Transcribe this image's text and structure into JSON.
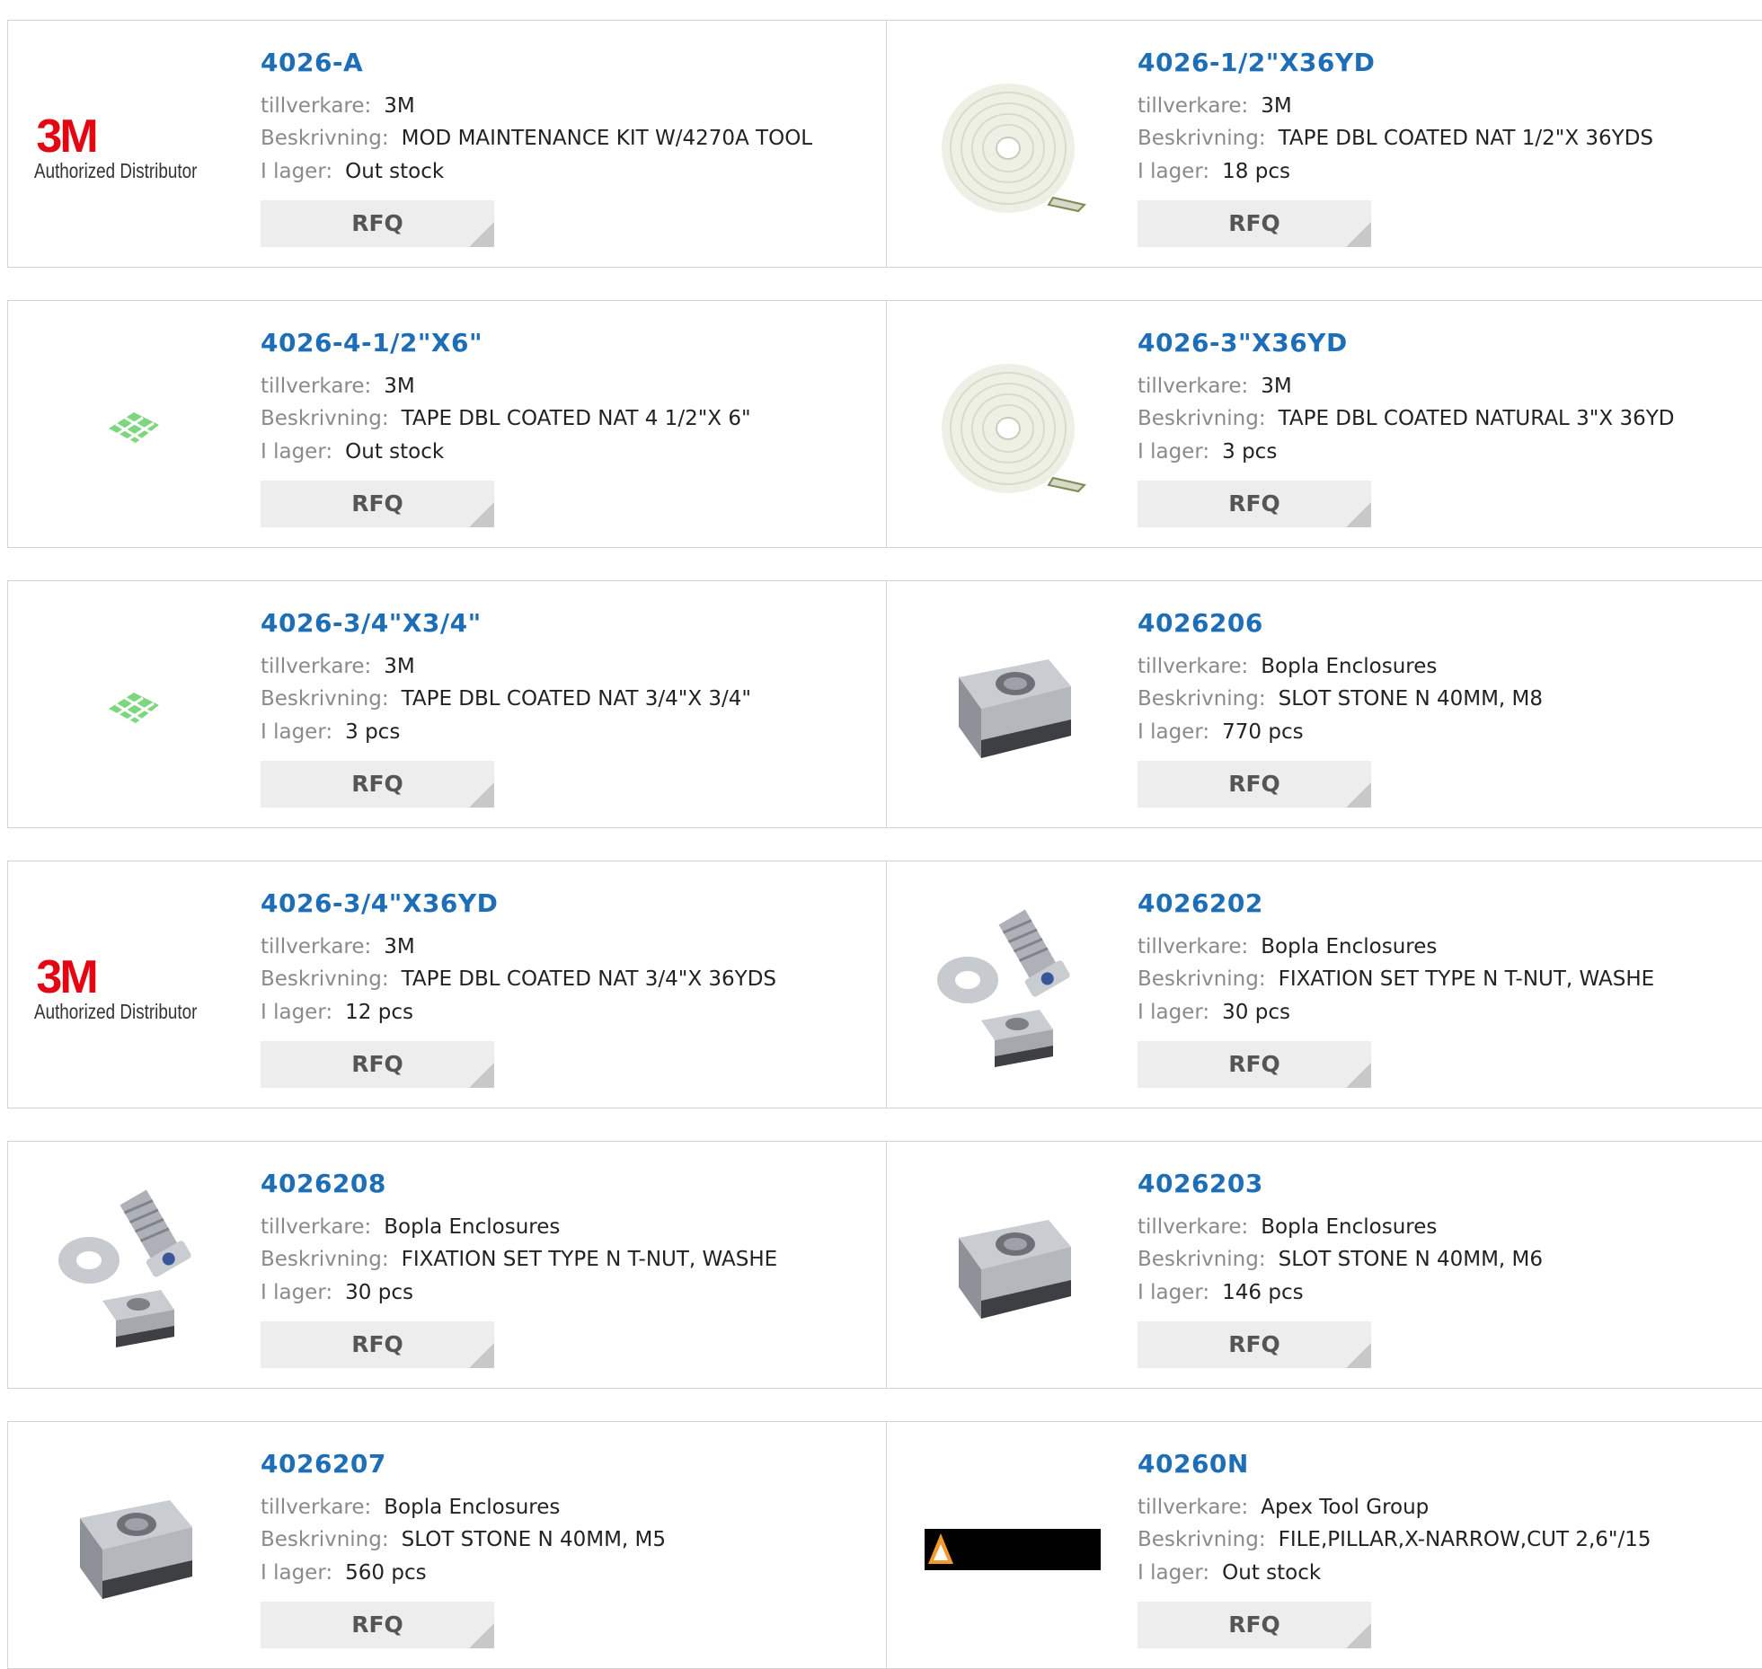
{
  "labels": {
    "manufacturer": "tillverkare:",
    "description": "Beskrivning:",
    "stock": "I lager:",
    "rfq": "RFQ"
  },
  "logo": {
    "mark": "3M",
    "tagline": "Authorized Distributor"
  },
  "products": [
    {
      "part": "4026-A",
      "manufacturer": "3M",
      "description": "MOD MAINTENANCE KIT W/4270A TOOL",
      "stock": "Out stock",
      "image": "3m-authorized-distributor-logo"
    },
    {
      "part": "4026-1/2\"X36YD",
      "manufacturer": "3M",
      "description": "TAPE DBL COATED NAT 1/2\"X 36YDS",
      "stock": "18 pcs",
      "image": "tape-roll"
    },
    {
      "part": "4026-4-1/2\"X6\"",
      "manufacturer": "3M",
      "description": "TAPE DBL COATED NAT 4 1/2\"X 6\"",
      "stock": "Out stock",
      "image": "tape-pad"
    },
    {
      "part": "4026-3\"X36YD",
      "manufacturer": "3M",
      "description": "TAPE DBL COATED NATURAL 3\"X 36YD",
      "stock": "3 pcs",
      "image": "tape-roll"
    },
    {
      "part": "4026-3/4\"X3/4\"",
      "manufacturer": "3M",
      "description": "TAPE DBL COATED NAT 3/4\"X 3/4\"",
      "stock": "3 pcs",
      "image": "tape-pad"
    },
    {
      "part": "4026206",
      "manufacturer": "Bopla Enclosures",
      "description": "SLOT STONE N 40MM, M8",
      "stock": "770 pcs",
      "image": "slot-stone"
    },
    {
      "part": "4026-3/4\"X36YD",
      "manufacturer": "3M",
      "description": "TAPE DBL COATED NAT 3/4\"X 36YDS",
      "stock": "12 pcs",
      "image": "3m-authorized-distributor-logo"
    },
    {
      "part": "4026202",
      "manufacturer": "Bopla Enclosures",
      "description": "FIXATION SET TYPE N T-NUT, WASHE",
      "stock": "30 pcs",
      "image": "fixation-set"
    },
    {
      "part": "4026208",
      "manufacturer": "Bopla Enclosures",
      "description": "FIXATION SET TYPE N T-NUT, WASHE",
      "stock": "30 pcs",
      "image": "fixation-set"
    },
    {
      "part": "4026203",
      "manufacturer": "Bopla Enclosures",
      "description": "SLOT STONE N 40MM, M6",
      "stock": "146 pcs",
      "image": "slot-stone"
    },
    {
      "part": "4026207",
      "manufacturer": "Bopla Enclosures",
      "description": "SLOT STONE N 40MM, M5",
      "stock": "560 pcs",
      "image": "slot-stone"
    },
    {
      "part": "40260N",
      "manufacturer": "Apex Tool Group",
      "description": "FILE,PILLAR,X-NARROW,CUT 2,6\"/15",
      "stock": "Out stock",
      "image": "apex-logo"
    }
  ],
  "colors": {
    "part_link": "#1d6eb6",
    "label_gray": "#8a8a8a",
    "rfq_bg": "#ededed",
    "border": "#d4d4d4",
    "logo_red": "#e30613"
  }
}
